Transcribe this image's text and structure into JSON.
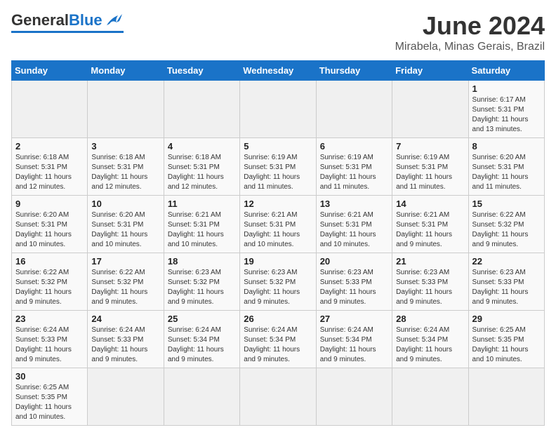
{
  "header": {
    "logo_general": "General",
    "logo_blue": "Blue",
    "month_title": "June 2024",
    "location": "Mirabela, Minas Gerais, Brazil"
  },
  "weekdays": [
    "Sunday",
    "Monday",
    "Tuesday",
    "Wednesday",
    "Thursday",
    "Friday",
    "Saturday"
  ],
  "weeks": [
    [
      {
        "day": "",
        "empty": true
      },
      {
        "day": "",
        "empty": true
      },
      {
        "day": "",
        "empty": true
      },
      {
        "day": "",
        "empty": true
      },
      {
        "day": "",
        "empty": true
      },
      {
        "day": "",
        "empty": true
      },
      {
        "day": "1",
        "sunrise": "Sunrise: 6:17 AM",
        "sunset": "Sunset: 5:31 PM",
        "daylight": "Daylight: 11 hours and 13 minutes."
      }
    ],
    [
      {
        "day": "2",
        "sunrise": "Sunrise: 6:18 AM",
        "sunset": "Sunset: 5:31 PM",
        "daylight": "Daylight: 11 hours and 12 minutes."
      },
      {
        "day": "3",
        "sunrise": "Sunrise: 6:18 AM",
        "sunset": "Sunset: 5:31 PM",
        "daylight": "Daylight: 11 hours and 12 minutes."
      },
      {
        "day": "4",
        "sunrise": "Sunrise: 6:18 AM",
        "sunset": "Sunset: 5:31 PM",
        "daylight": "Daylight: 11 hours and 12 minutes."
      },
      {
        "day": "5",
        "sunrise": "Sunrise: 6:19 AM",
        "sunset": "Sunset: 5:31 PM",
        "daylight": "Daylight: 11 hours and 11 minutes."
      },
      {
        "day": "6",
        "sunrise": "Sunrise: 6:19 AM",
        "sunset": "Sunset: 5:31 PM",
        "daylight": "Daylight: 11 hours and 11 minutes."
      },
      {
        "day": "7",
        "sunrise": "Sunrise: 6:19 AM",
        "sunset": "Sunset: 5:31 PM",
        "daylight": "Daylight: 11 hours and 11 minutes."
      },
      {
        "day": "8",
        "sunrise": "Sunrise: 6:20 AM",
        "sunset": "Sunset: 5:31 PM",
        "daylight": "Daylight: 11 hours and 11 minutes."
      }
    ],
    [
      {
        "day": "9",
        "sunrise": "Sunrise: 6:20 AM",
        "sunset": "Sunset: 5:31 PM",
        "daylight": "Daylight: 11 hours and 10 minutes."
      },
      {
        "day": "10",
        "sunrise": "Sunrise: 6:20 AM",
        "sunset": "Sunset: 5:31 PM",
        "daylight": "Daylight: 11 hours and 10 minutes."
      },
      {
        "day": "11",
        "sunrise": "Sunrise: 6:21 AM",
        "sunset": "Sunset: 5:31 PM",
        "daylight": "Daylight: 11 hours and 10 minutes."
      },
      {
        "day": "12",
        "sunrise": "Sunrise: 6:21 AM",
        "sunset": "Sunset: 5:31 PM",
        "daylight": "Daylight: 11 hours and 10 minutes."
      },
      {
        "day": "13",
        "sunrise": "Sunrise: 6:21 AM",
        "sunset": "Sunset: 5:31 PM",
        "daylight": "Daylight: 11 hours and 10 minutes."
      },
      {
        "day": "14",
        "sunrise": "Sunrise: 6:21 AM",
        "sunset": "Sunset: 5:31 PM",
        "daylight": "Daylight: 11 hours and 9 minutes."
      },
      {
        "day": "15",
        "sunrise": "Sunrise: 6:22 AM",
        "sunset": "Sunset: 5:32 PM",
        "daylight": "Daylight: 11 hours and 9 minutes."
      }
    ],
    [
      {
        "day": "16",
        "sunrise": "Sunrise: 6:22 AM",
        "sunset": "Sunset: 5:32 PM",
        "daylight": "Daylight: 11 hours and 9 minutes."
      },
      {
        "day": "17",
        "sunrise": "Sunrise: 6:22 AM",
        "sunset": "Sunset: 5:32 PM",
        "daylight": "Daylight: 11 hours and 9 minutes."
      },
      {
        "day": "18",
        "sunrise": "Sunrise: 6:23 AM",
        "sunset": "Sunset: 5:32 PM",
        "daylight": "Daylight: 11 hours and 9 minutes."
      },
      {
        "day": "19",
        "sunrise": "Sunrise: 6:23 AM",
        "sunset": "Sunset: 5:32 PM",
        "daylight": "Daylight: 11 hours and 9 minutes."
      },
      {
        "day": "20",
        "sunrise": "Sunrise: 6:23 AM",
        "sunset": "Sunset: 5:33 PM",
        "daylight": "Daylight: 11 hours and 9 minutes."
      },
      {
        "day": "21",
        "sunrise": "Sunrise: 6:23 AM",
        "sunset": "Sunset: 5:33 PM",
        "daylight": "Daylight: 11 hours and 9 minutes."
      },
      {
        "day": "22",
        "sunrise": "Sunrise: 6:23 AM",
        "sunset": "Sunset: 5:33 PM",
        "daylight": "Daylight: 11 hours and 9 minutes."
      }
    ],
    [
      {
        "day": "23",
        "sunrise": "Sunrise: 6:24 AM",
        "sunset": "Sunset: 5:33 PM",
        "daylight": "Daylight: 11 hours and 9 minutes."
      },
      {
        "day": "24",
        "sunrise": "Sunrise: 6:24 AM",
        "sunset": "Sunset: 5:33 PM",
        "daylight": "Daylight: 11 hours and 9 minutes."
      },
      {
        "day": "25",
        "sunrise": "Sunrise: 6:24 AM",
        "sunset": "Sunset: 5:34 PM",
        "daylight": "Daylight: 11 hours and 9 minutes."
      },
      {
        "day": "26",
        "sunrise": "Sunrise: 6:24 AM",
        "sunset": "Sunset: 5:34 PM",
        "daylight": "Daylight: 11 hours and 9 minutes."
      },
      {
        "day": "27",
        "sunrise": "Sunrise: 6:24 AM",
        "sunset": "Sunset: 5:34 PM",
        "daylight": "Daylight: 11 hours and 9 minutes."
      },
      {
        "day": "28",
        "sunrise": "Sunrise: 6:24 AM",
        "sunset": "Sunset: 5:34 PM",
        "daylight": "Daylight: 11 hours and 9 minutes."
      },
      {
        "day": "29",
        "sunrise": "Sunrise: 6:25 AM",
        "sunset": "Sunset: 5:35 PM",
        "daylight": "Daylight: 11 hours and 10 minutes."
      }
    ],
    [
      {
        "day": "30",
        "sunrise": "Sunrise: 6:25 AM",
        "sunset": "Sunset: 5:35 PM",
        "daylight": "Daylight: 11 hours and 10 minutes."
      },
      {
        "day": "",
        "empty": true
      },
      {
        "day": "",
        "empty": true
      },
      {
        "day": "",
        "empty": true
      },
      {
        "day": "",
        "empty": true
      },
      {
        "day": "",
        "empty": true
      },
      {
        "day": "",
        "empty": true
      }
    ]
  ]
}
